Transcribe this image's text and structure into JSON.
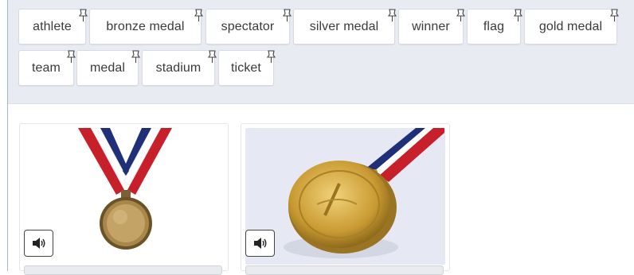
{
  "word_bank": {
    "words": [
      "athlete",
      "bronze medal",
      "spectator",
      "silver medal",
      "winner",
      "flag",
      "gold medal",
      "team",
      "medal",
      "stadium",
      "ticket"
    ]
  },
  "icons": {
    "chip_marker": "pushpin-icon",
    "audio": "speaker-icon"
  },
  "colors": {
    "bank_background": "#e8ecf2",
    "ribbon_red": "#c8202b",
    "ribbon_blue": "#1f2f78",
    "gold": "#c9a23a",
    "bronze": "#8a6a35"
  }
}
